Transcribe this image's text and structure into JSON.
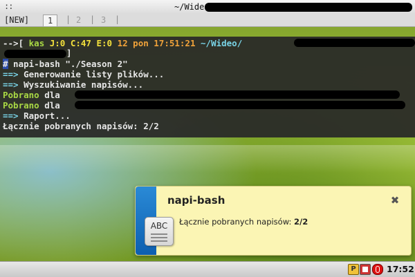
{
  "window": {
    "title": "~/Wideo/"
  },
  "tabs": [
    {
      "label": "[NEW]"
    },
    {
      "label": "1"
    },
    {
      "label": "2"
    },
    {
      "label": "3"
    }
  ],
  "terminal": {
    "prompt_prefix": "-->[",
    "prompt_user": "kas",
    "prompt_stats": "J:0 C:47 E:0",
    "prompt_date": "12 pon 17:51:21",
    "prompt_path": "~/Wideo/",
    "prompt_close": "]",
    "cmd_hash": "#",
    "command": " napi-bash \"./Season 2\"",
    "line_generate_arrow": "==>",
    "line_generate_text": " Generowanie listy plików...",
    "line_search_arrow": "==>",
    "line_search_text": " Wyszukiwanie napisów...",
    "pobrano_label": "Pobrano",
    "pobrano_dla": " dla",
    "line_report_arrow": "==>",
    "line_report_text": " Raport...",
    "summary": "Łącznie pobranych napisów: 2/2"
  },
  "notification": {
    "title": "napi-bash",
    "body_text": "Łącznie pobranych napisów: ",
    "body_value": "2/2",
    "icon_text": "ABC",
    "close_glyph": "✖"
  },
  "taskbar": {
    "tray_p_label": "P",
    "clock": "17:52"
  },
  "colors": {
    "terminal_bg": "#282828",
    "prompt_green": "#a9d844",
    "prompt_yellow": "#f4e13c",
    "prompt_orange": "#f0a23a",
    "prompt_cyan": "#79d3e6",
    "notify_bg": "#fbf5b4",
    "notify_accent": "#0d5fb0"
  }
}
